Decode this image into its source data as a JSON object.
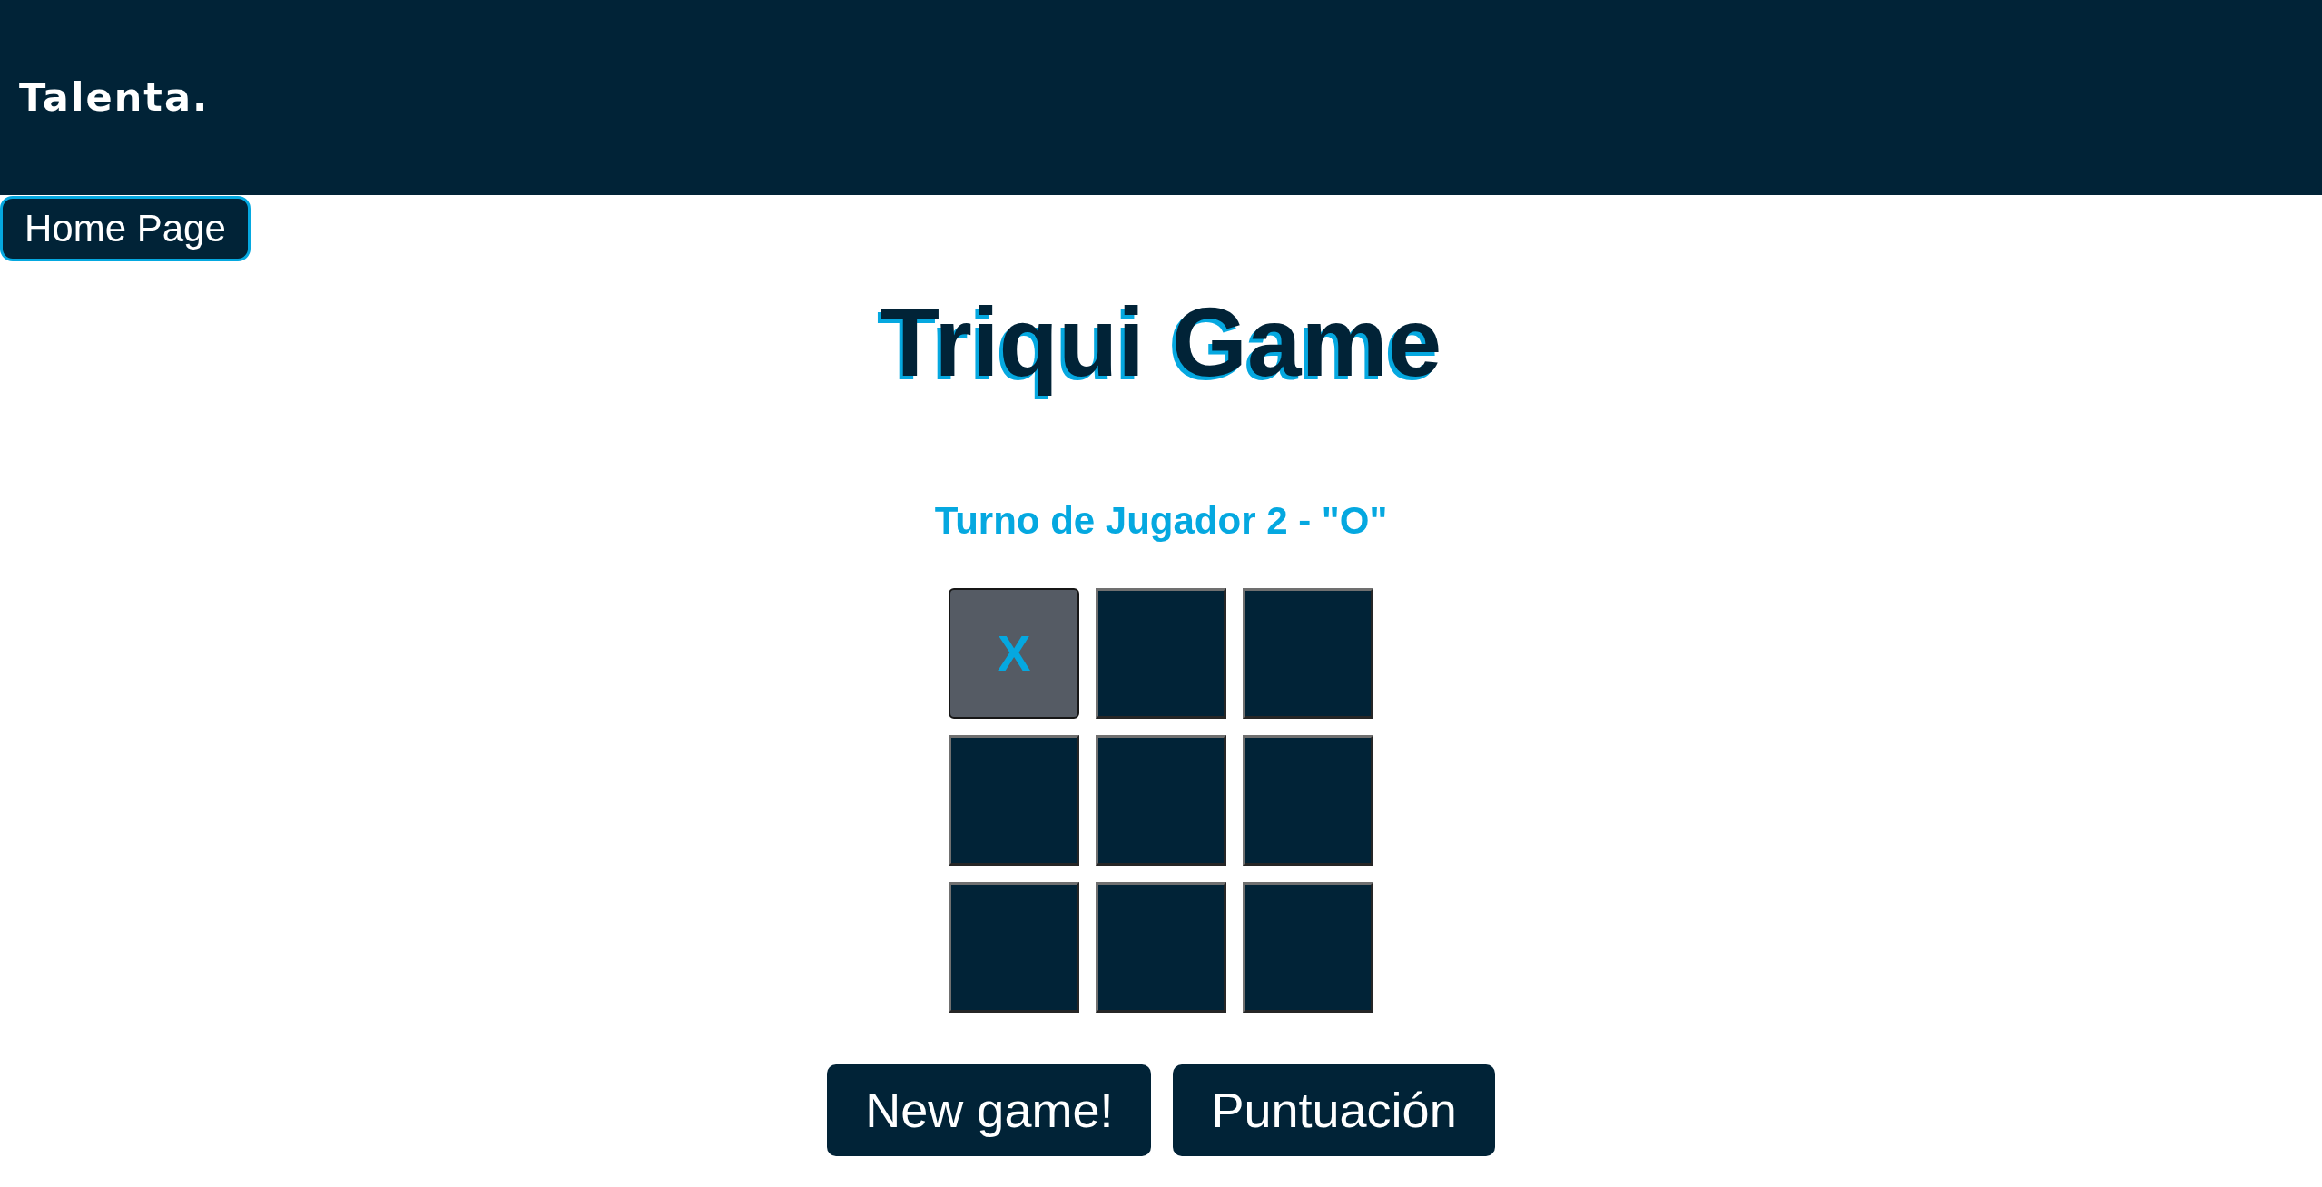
{
  "header": {
    "logo": "Talenta."
  },
  "home_button": {
    "label": "Home Page"
  },
  "title": "Triqui Game",
  "turn_message": "Turno de Jugador 2 - \"O\"",
  "board": {
    "cells": [
      {
        "mark": "X",
        "disabled": true
      },
      {
        "disabled": false
      },
      {
        "disabled": false
      },
      {
        "disabled": false
      },
      {
        "disabled": false
      },
      {
        "disabled": false
      },
      {
        "disabled": false
      },
      {
        "disabled": false
      },
      {
        "disabled": false
      }
    ]
  },
  "buttons": [
    {
      "label": "New game!"
    },
    {
      "label": "Puntuación"
    }
  ]
}
